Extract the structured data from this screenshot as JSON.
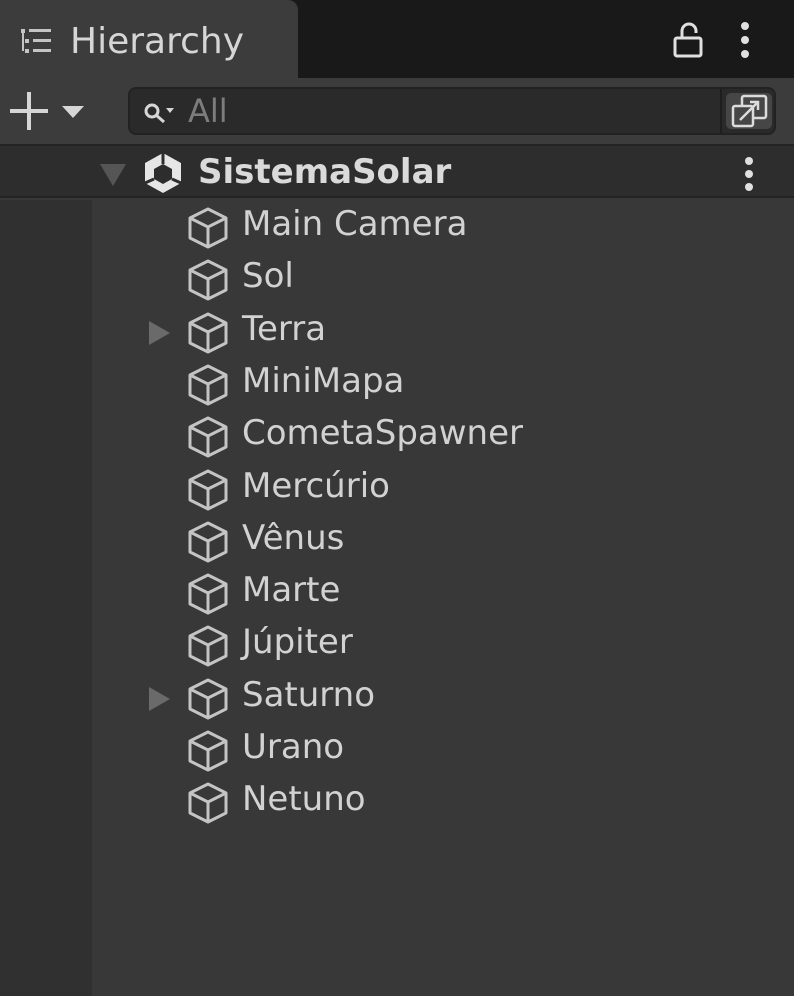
{
  "panel": {
    "title": "Hierarchy",
    "tab_icon": "hierarchy-list-icon",
    "lock_icon": "lock-open-icon",
    "menu_icon": "kebab-menu-icon"
  },
  "toolbar": {
    "add_icon": "plus-dropdown-icon",
    "search": {
      "placeholder": "All",
      "value": "",
      "search_icon": "search-icon",
      "mode_icon": "search-mode-icon"
    }
  },
  "scene": {
    "name": "SistemaSolar",
    "expanded": true,
    "icon": "unity-scene-icon"
  },
  "objects": [
    {
      "name": "Main Camera",
      "has_children": false
    },
    {
      "name": "Sol",
      "has_children": false
    },
    {
      "name": "Terra",
      "has_children": true
    },
    {
      "name": "MiniMapa",
      "has_children": false
    },
    {
      "name": "CometaSpawner",
      "has_children": false
    },
    {
      "name": "Mercúrio",
      "has_children": false
    },
    {
      "name": "Vênus",
      "has_children": false
    },
    {
      "name": "Marte",
      "has_children": false
    },
    {
      "name": "Júpiter",
      "has_children": false
    },
    {
      "name": "Saturno",
      "has_children": true
    },
    {
      "name": "Urano",
      "has_children": false
    },
    {
      "name": "Netuno",
      "has_children": false
    }
  ],
  "colors": {
    "background": "#383838",
    "tab_bar": "#191919",
    "text": "#d2d2d2",
    "icon": "#c4c4c4"
  }
}
